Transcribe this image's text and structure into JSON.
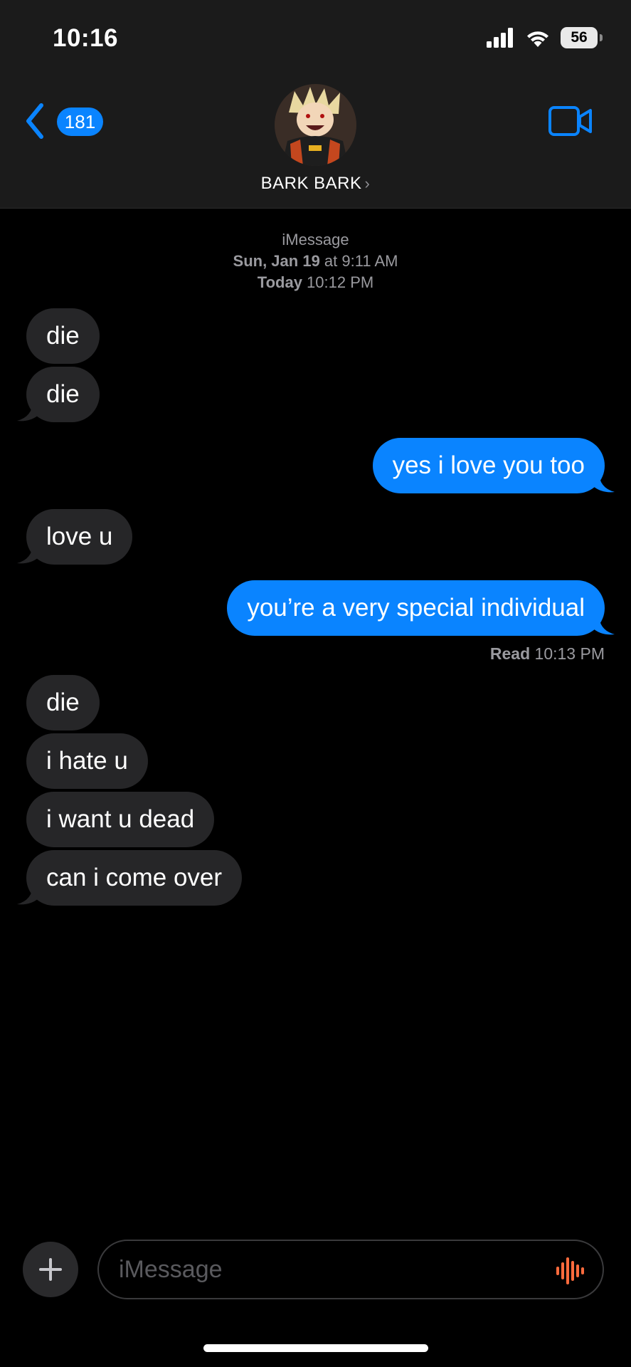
{
  "status_bar": {
    "time": "10:16",
    "battery": "56"
  },
  "nav": {
    "unread_count": "181",
    "contact_name": "BARK BARK",
    "contact_chevron": "›"
  },
  "thread_header": {
    "service": "iMessage",
    "first_date_bold": "Sun, Jan 19",
    "first_date_rest": " at 9:11 AM",
    "today_bold": "Today",
    "today_rest": " 10:12 PM"
  },
  "messages": [
    {
      "text": "die",
      "direction": "received"
    },
    {
      "text": "die",
      "direction": "received"
    },
    {
      "text": "yes i love you too",
      "direction": "sent"
    },
    {
      "text": "love u",
      "direction": "received"
    },
    {
      "text": "you’re a very special individual",
      "direction": "sent"
    },
    {
      "text": "die",
      "direction": "received"
    },
    {
      "text": "i hate u",
      "direction": "received"
    },
    {
      "text": "i want u dead",
      "direction": "received"
    },
    {
      "text": "can i come over",
      "direction": "received"
    }
  ],
  "read_receipt": {
    "label": "Read",
    "time": " 10:13 PM"
  },
  "composer": {
    "placeholder": "iMessage"
  },
  "colors": {
    "accent": "#0a84ff",
    "received_bubble": "#262628",
    "audio_icon": "#ff6b3d"
  },
  "icons": [
    "back-chevron-icon",
    "video-camera-icon",
    "plus-icon",
    "audio-waveform-icon",
    "signal-icon",
    "wifi-icon",
    "battery-icon"
  ]
}
